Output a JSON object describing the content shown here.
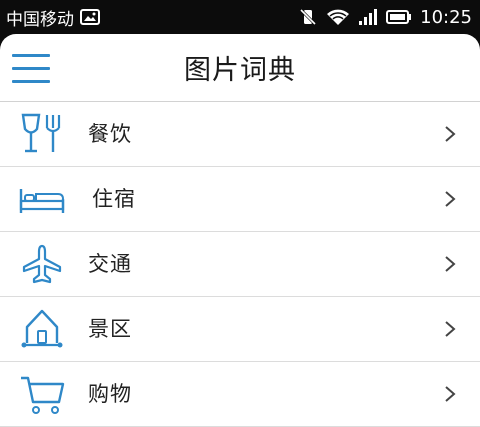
{
  "status_bar": {
    "carrier": "中国移动",
    "time": "10:25",
    "icons": [
      "image-notification-icon",
      "vibrate-muted-icon",
      "wifi-icon",
      "signal-icon",
      "battery-icon"
    ]
  },
  "header": {
    "title": "图片词典",
    "menu_icon": "hamburger-menu-icon",
    "accent_color": "#2f88c8"
  },
  "categories": [
    {
      "label": "餐饮",
      "icon": "dining-icon"
    },
    {
      "label": "住宿",
      "icon": "bed-icon"
    },
    {
      "label": "交通",
      "icon": "airplane-icon"
    },
    {
      "label": "景区",
      "icon": "house-icon"
    },
    {
      "label": "购物",
      "icon": "shopping-cart-icon"
    }
  ]
}
